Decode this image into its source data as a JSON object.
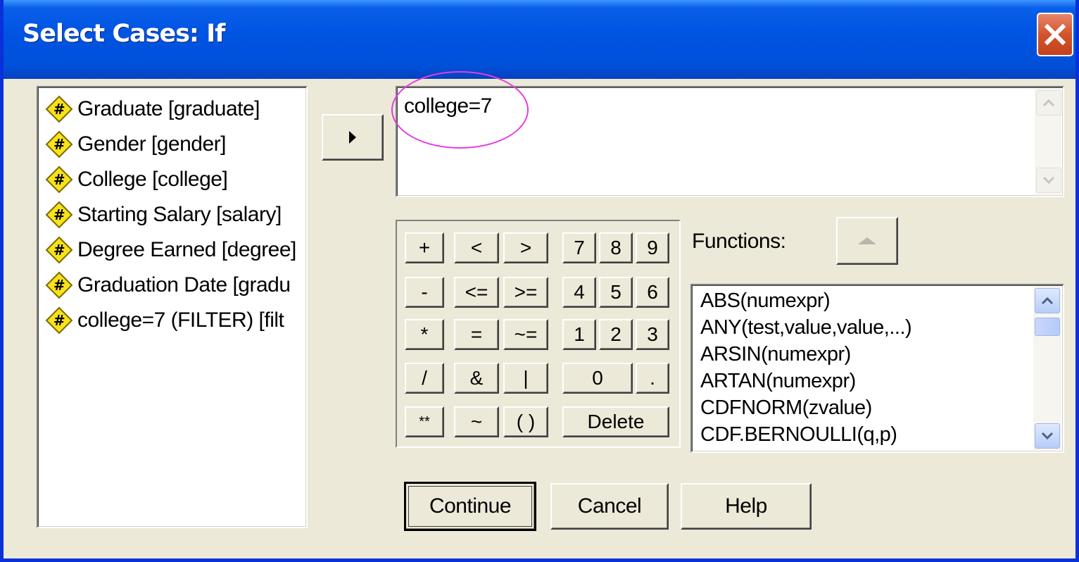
{
  "window": {
    "title": "Select Cases: If"
  },
  "variables": [
    "Graduate [graduate]",
    "Gender [gender]",
    "College [college]",
    "Starting Salary [salary]",
    "Degree Earned [degree]",
    "Graduation Date [gradu",
    "college=7 (FILTER) [filt"
  ],
  "expression": {
    "value": "college=7"
  },
  "keypad": {
    "keys": [
      "+",
      "<",
      ">",
      "7",
      "8",
      "9",
      "-",
      "<=",
      ">=",
      "4",
      "5",
      "6",
      "*",
      "=",
      "~=",
      "1",
      "2",
      "3",
      "/",
      "&",
      "|",
      "0",
      ".",
      "**",
      "~",
      "( )",
      "Delete"
    ]
  },
  "functions": {
    "label": "Functions:",
    "items": [
      "ABS(numexpr)",
      "ANY(test,value,value,...)",
      "ARSIN(numexpr)",
      "ARTAN(numexpr)",
      "CDFNORM(zvalue)",
      "CDF.BERNOULLI(q,p)"
    ]
  },
  "buttons": {
    "continue": "Continue",
    "cancel": "Cancel",
    "help": "Help"
  },
  "colors": {
    "titlebar": "#0054E3",
    "dialog_bg": "#ECE9D8",
    "highlight_ellipse": "#E43CE1"
  }
}
